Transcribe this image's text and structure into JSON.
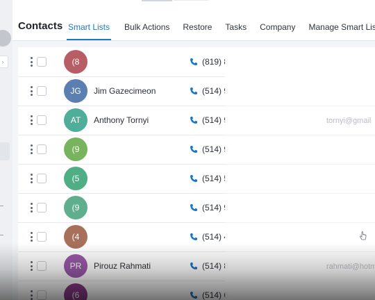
{
  "header": {
    "title": "Contacts",
    "tabs": [
      {
        "label": "Smart Lists",
        "active": true
      },
      {
        "label": "Bulk Actions",
        "active": false
      },
      {
        "label": "Restore",
        "active": false
      },
      {
        "label": "Tasks",
        "active": false
      },
      {
        "label": "Company",
        "active": false
      },
      {
        "label": "Manage Smart Lists",
        "active": false
      }
    ]
  },
  "contacts": [
    {
      "initials": "(8",
      "name": "",
      "phone": "(819) 8",
      "color": "#b85c66"
    },
    {
      "initials": "JG",
      "name": "Jim Gazecimeon",
      "phone": "(514) 9",
      "color": "#5b7fb0"
    },
    {
      "initials": "AT",
      "name": "Anthony Tornyi",
      "phone": "(514) 9",
      "color": "#4fae9a"
    },
    {
      "initials": "(9",
      "name": "",
      "phone": "(514) 9",
      "color": "#78b45e"
    },
    {
      "initials": "(5",
      "name": "",
      "phone": "(514) 5",
      "color": "#4fae86"
    },
    {
      "initials": "(9",
      "name": "",
      "phone": "(514) 9",
      "color": "#5fae8e"
    },
    {
      "initials": "(4",
      "name": "",
      "phone": "(514) 4",
      "color": "#a8705a"
    },
    {
      "initials": "PR",
      "name": "Pirouz Rahmati",
      "phone": "(514) 8",
      "color": "#9a5aa8"
    },
    {
      "initials": "(6",
      "name": "",
      "phone": "(514) 6",
      "color": "#8a3a86"
    }
  ],
  "email_fragments": [
    "tornyi@gmail",
    "rahmati@hotm"
  ],
  "colors": {
    "accent": "#1a78c2",
    "phone_icon": "#1a78c2"
  }
}
